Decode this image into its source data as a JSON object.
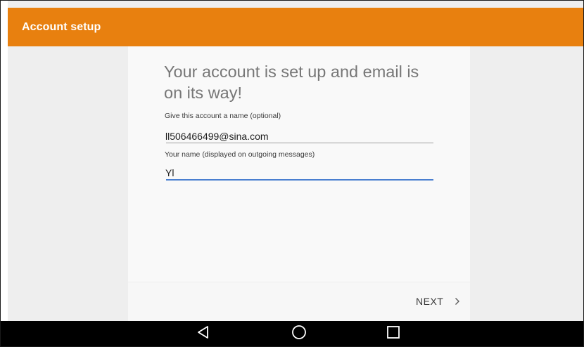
{
  "appbar": {
    "title": "Account setup",
    "color": "#e8800f"
  },
  "setup": {
    "headline_line1": "Your account is set up and email is",
    "headline_line2": "on its way!",
    "account_name": {
      "label": "Give this account a name (optional)",
      "value": "ll506466499@sina.com"
    },
    "your_name": {
      "label": "Your name (displayed on outgoing messages)",
      "value": "Yl"
    },
    "next_label": "NEXT"
  },
  "colors": {
    "accent_underline": "#4a7fd0",
    "navbar": "#000000"
  },
  "navbar": {
    "buttons": [
      "back-icon",
      "home-icon",
      "recents-icon"
    ]
  }
}
